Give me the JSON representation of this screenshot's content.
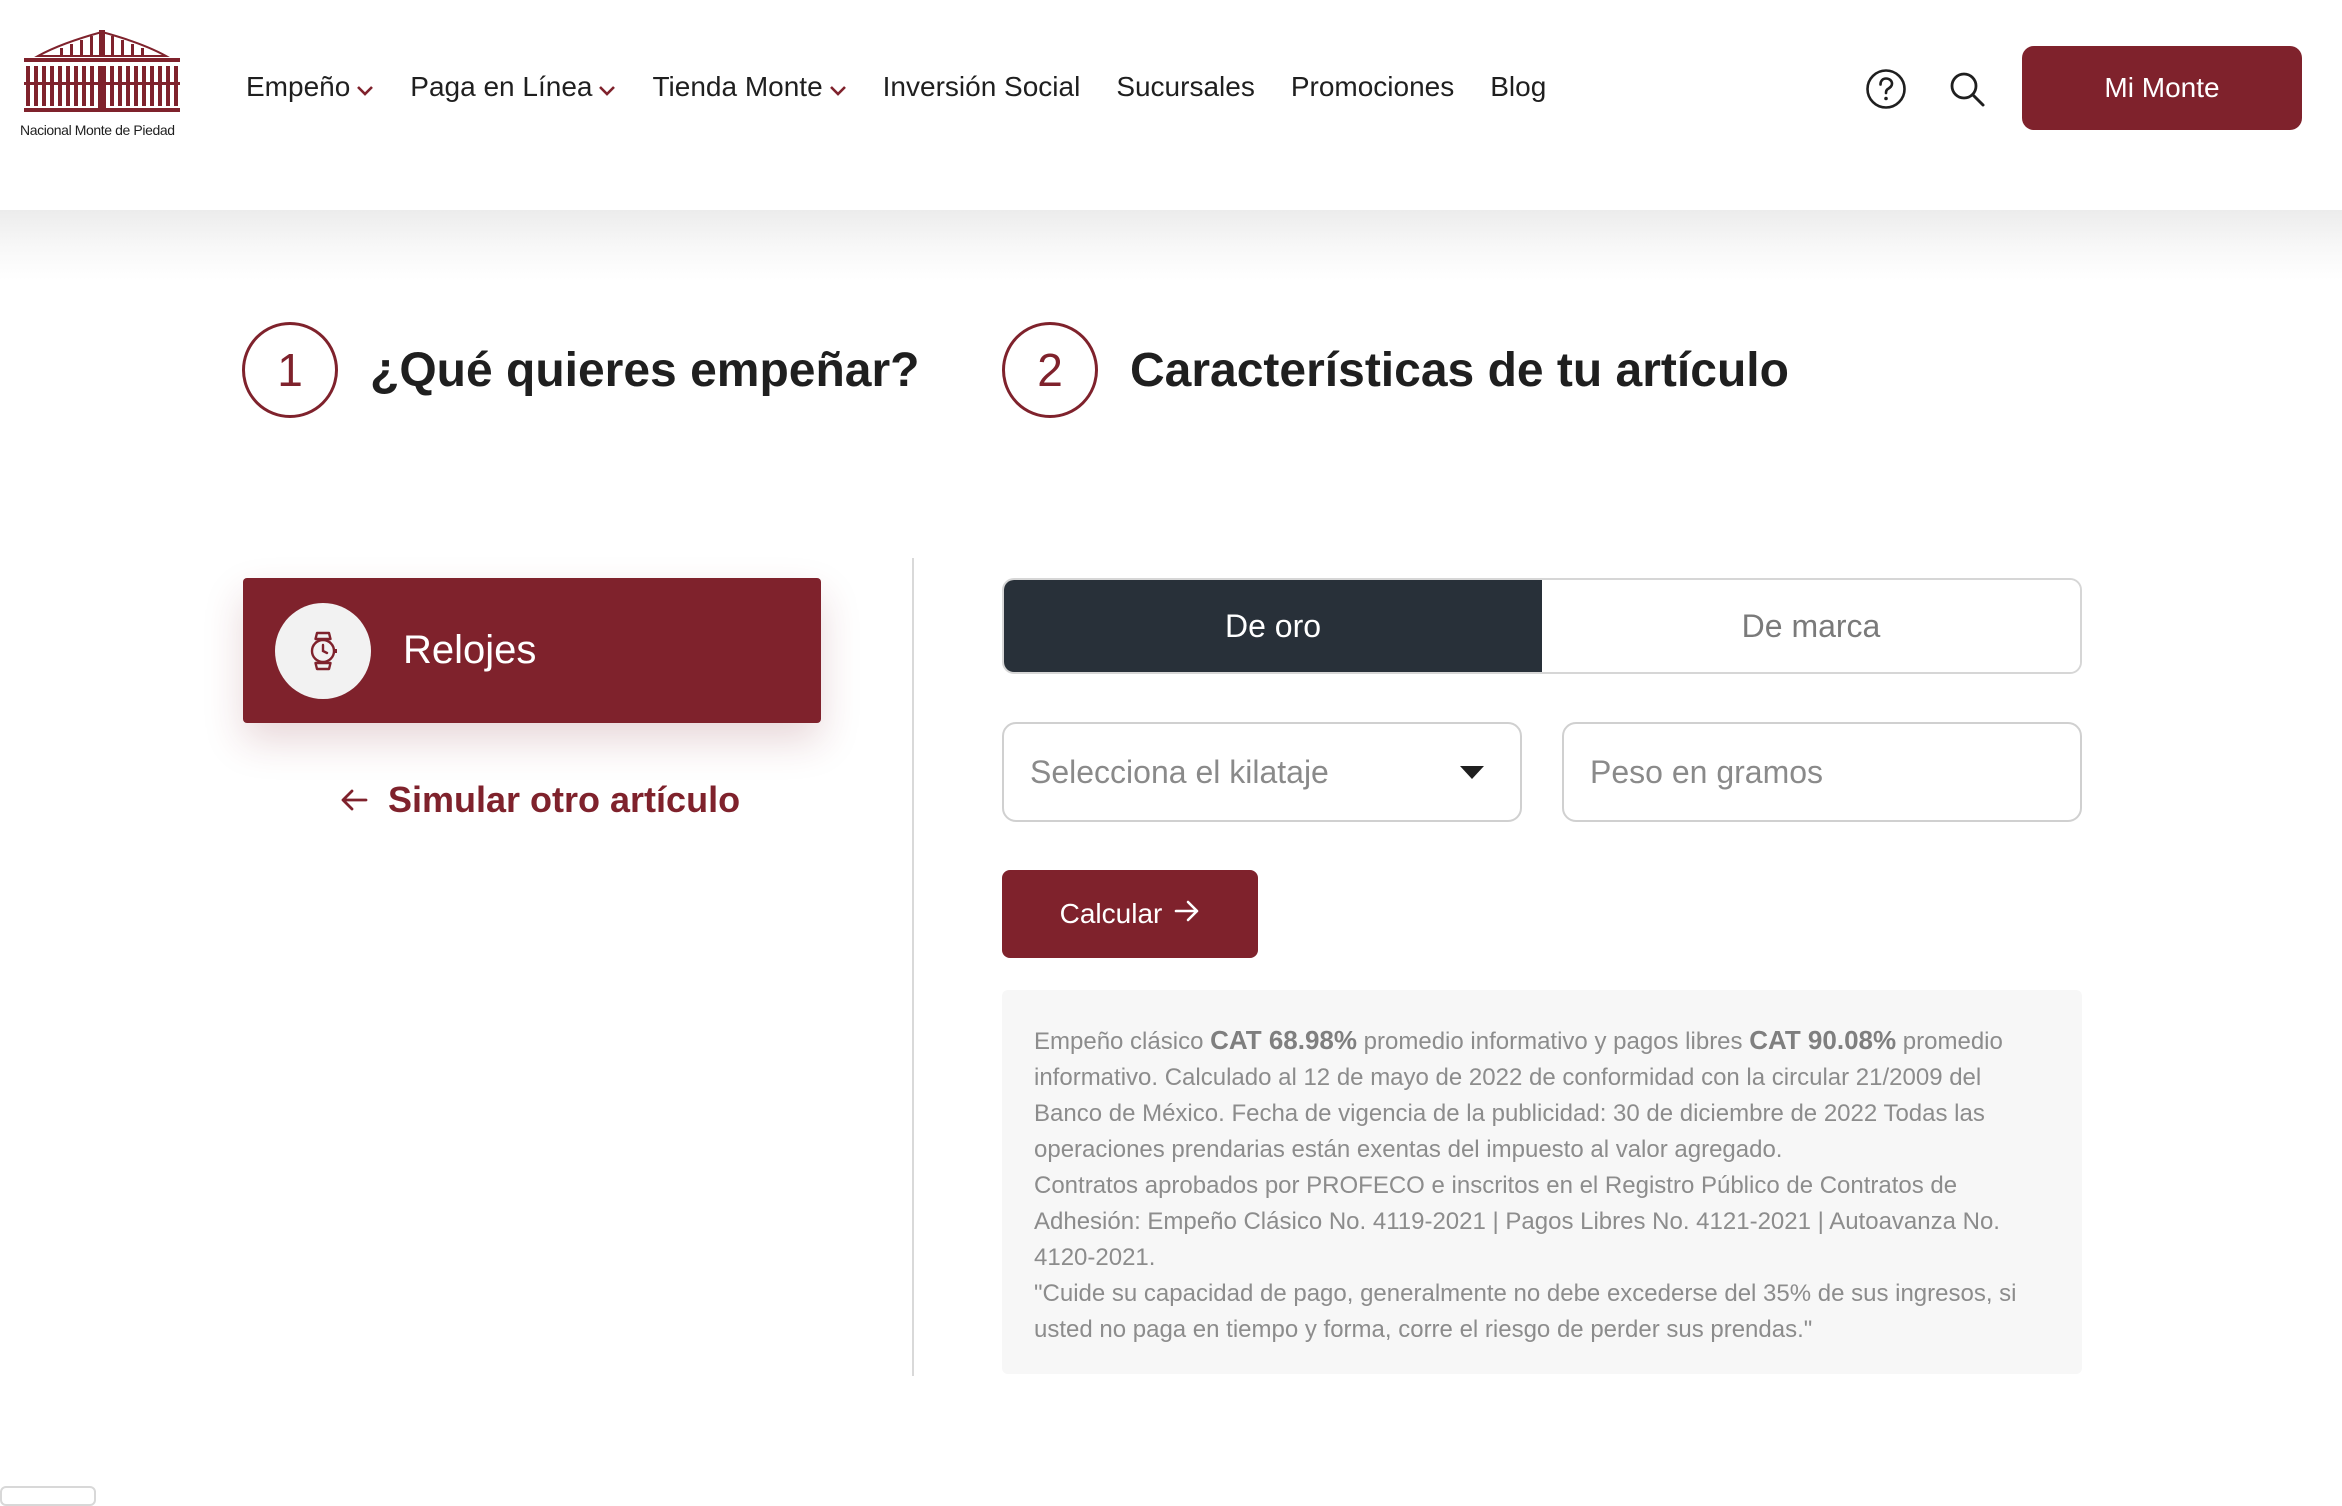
{
  "header": {
    "logo_text": "Nacional Monte de Piedad",
    "nav": [
      {
        "label": "Empeño",
        "has_dropdown": true
      },
      {
        "label": "Paga en Línea",
        "has_dropdown": true
      },
      {
        "label": "Tienda Monte",
        "has_dropdown": true
      },
      {
        "label": "Inversión Social",
        "has_dropdown": false
      },
      {
        "label": "Sucursales",
        "has_dropdown": false
      },
      {
        "label": "Promociones",
        "has_dropdown": false
      },
      {
        "label": "Blog",
        "has_dropdown": false
      }
    ],
    "help_icon": "help-circle-icon",
    "search_icon": "search-icon",
    "account_button": "Mi Monte"
  },
  "steps": [
    {
      "number": "1",
      "title": "¿Qué quieres empeñar?"
    },
    {
      "number": "2",
      "title": "Características de tu artículo"
    }
  ],
  "selected_category": {
    "label": "Relojes",
    "icon": "watch-icon"
  },
  "back_link": "Simular otro artículo",
  "tabs": [
    {
      "label": "De oro",
      "active": true
    },
    {
      "label": "De marca",
      "active": false
    }
  ],
  "form": {
    "karat_select": {
      "value": "Selecciona el kilataje"
    },
    "weight_input": {
      "placeholder": "Peso en gramos",
      "value": ""
    },
    "submit": "Calcular"
  },
  "legal": {
    "p1_a": "Empeño clásico ",
    "p1_cat1": "CAT 68.98%",
    "p1_b": " promedio informativo y pagos libres ",
    "p1_cat2": "CAT 90.08%",
    "p1_c": " promedio informativo. Calculado al 12 de mayo de 2022 de conformidad con la circular 21/2009 del Banco de México. Fecha de vigencia de la publicidad: 30 de diciembre de 2022 Todas las operaciones prendarias están exentas del impuesto al valor agregado.",
    "p2": "Contratos aprobados por PROFECO e inscritos en el Registro Público de Contratos de Adhesión: Empeño Clásico No. 4119-2021 | Pagos Libres No. 4121-2021 | Autoavanza No. 4120-2021.",
    "p3": "\"Cuide su capacidad de pago, generalmente no debe excederse del 35% de sus ingresos, si usted no paga en tiempo y forma, corre el riesgo de perder sus prendas.\""
  },
  "colors": {
    "brand": "#7f222c",
    "tab_active": "#283039",
    "text": "#1f1f1f",
    "muted": "#8c8c8c"
  }
}
